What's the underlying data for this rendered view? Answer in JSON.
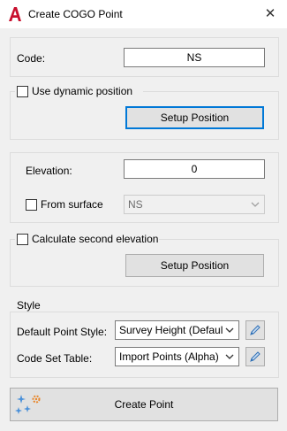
{
  "window": {
    "title": "Create COGO Point",
    "close_glyph": "✕"
  },
  "code": {
    "label": "Code:",
    "value": "NS"
  },
  "dynamic": {
    "checkbox_label": "Use dynamic position",
    "checked": false,
    "setup_button": "Setup Position"
  },
  "elevation": {
    "label": "Elevation:",
    "value": "0",
    "from_surface_label": "From surface",
    "from_surface_checked": false,
    "surface_value": "NS"
  },
  "second_elevation": {
    "checkbox_label": "Calculate second elevation",
    "checked": false,
    "setup_button": "Setup Position"
  },
  "style": {
    "group_label": "Style",
    "default_point_style_label": "Default Point Style:",
    "default_point_style_value": "Survey Height (Default)",
    "code_set_table_label": "Code Set Table:",
    "code_set_table_value": "Import Points (Alpha)"
  },
  "create_button": {
    "label": "Create Point"
  },
  "colors": {
    "accent_blue": "#0078d7",
    "app_icon_red": "#c8102e",
    "pencil_blue": "#2e6fb5"
  },
  "icons": [
    "autocad-app-icon",
    "close-icon",
    "chevron-down-icon",
    "pencil-icon",
    "create-point-icon"
  ]
}
